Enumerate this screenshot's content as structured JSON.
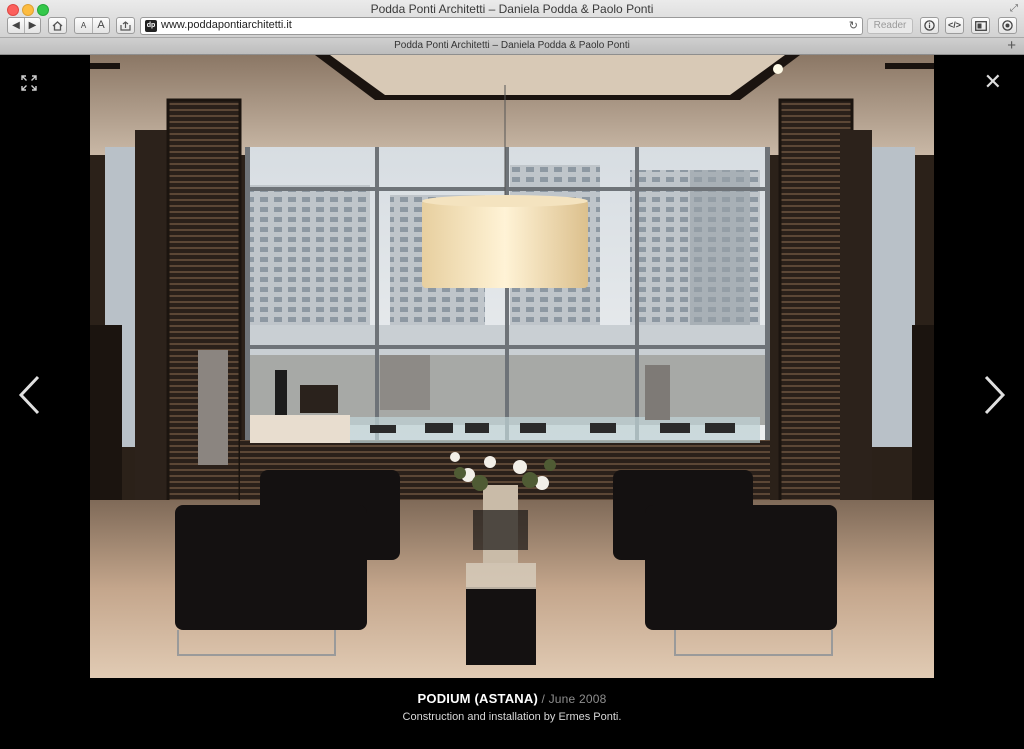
{
  "browser": {
    "window_title": "Podda Ponti Architetti – Daniela Podda & Paolo Ponti",
    "tab_title": "Podda Ponti Architetti – Daniela Podda & Paolo Ponti",
    "url": "www.poddapontiarchitetti.it",
    "favicon_text": "dp",
    "reader_label": "Reader",
    "font_small_label": "A",
    "font_large_label": "A",
    "icons": [
      "back-icon",
      "forward-icon",
      "home-icon",
      "share-icon",
      "reload-icon",
      "info-icon",
      "code-icon",
      "sidebar-icon",
      "download-icon",
      "add-tab-icon",
      "fullscreen-icon"
    ]
  },
  "lightbox": {
    "title": "PODIUM (ASTANA)",
    "separator": " / ",
    "date": "June 2008",
    "subtitle": "Construction and installation by Ermes Ponti.",
    "icons": [
      "expand-icon",
      "close-icon",
      "prev-arrow-icon",
      "next-arrow-icon"
    ]
  },
  "colors": {
    "background": "#000000",
    "caption_title": "#ffffff",
    "caption_date": "#8e8e8e"
  }
}
